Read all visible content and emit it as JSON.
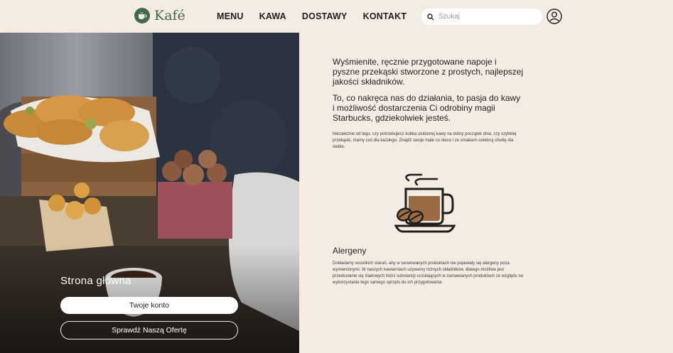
{
  "header": {
    "logo_text": "Kafé",
    "nav": [
      "MENU",
      "KAWA",
      "DOSTAWY",
      "KONTAKT"
    ],
    "search_placeholder": "Szukaj"
  },
  "hero": {
    "title": "Strona główna",
    "account_button": "Twoje konto",
    "offer_button": "Sprawdź Naszą Ofertę"
  },
  "content": {
    "lead1": "Wyśmienite, ręcznie przygotowane napoje i pyszne przekąski stworzone z prostych, najlepszej jakości składników.",
    "lead2": "To, co nakręca nas do działania, to pasja do kawy i możliwość dostarczenia Ci odrobiny magii Starbucks, gdziekolwiek jesteś.",
    "small": "Niezależnie od tego, czy potrzebujesz kubka ulubionej kawy na dobry początek dnia, czy szybkiej przekąski, mamy coś dla każdego. Znajdź swoje małe co nieco i ze smakiem celebruj chwilę dla siebie.",
    "allergens_title": "Alergeny",
    "allergens_text": "Dokładamy wszelkich starań, aby w serwowanych produktach nie pojawiały się alergeny poza wymienionymi. W naszych kawiarniach używamy różnych składników, dlatego możliwe jest przedostanie się śladowych ilości substancji uczulających w zamawianych produktach ze względu na wykorzystanie tego samego sprzętu do ich przygotowania."
  },
  "colors": {
    "brand_green": "#3f6b47",
    "background": "#f4ebe2",
    "coffee": "#9a6a45"
  }
}
